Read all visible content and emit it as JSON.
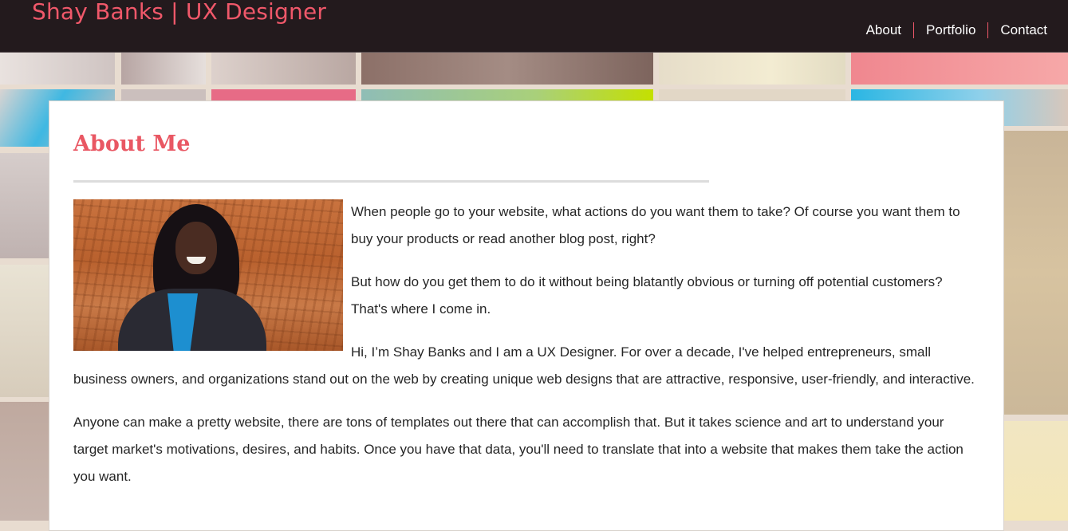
{
  "header": {
    "site_title": "Shay Banks | UX Designer",
    "nav": [
      "About",
      "Portfolio",
      "Contact"
    ],
    "colors": {
      "bar": "#231a1d",
      "title": "#f0586a",
      "divider": "#f0586a"
    }
  },
  "about": {
    "heading": "About Me",
    "image_alt": "Portrait of Shay Banks",
    "paragraphs": [
      "When people go to your website, what actions do you want them to take? Of course you want them to buy your products or read another blog post, right?",
      "But how do you get them to do it without being blatantly obvious or turning off potential customers? That's where I come in.",
      "Hi, I’m Shay Banks and I am a UX Designer. For over a decade, I've helped entrepreneurs, small business owners, and organizations stand out on the web by creating unique web designs that are attractive, responsive, user-friendly, and interactive.",
      "Anyone can make a pretty website, there are tons of templates out there that can accomplish that. But it takes science and art to understand your target market's motivations, desires, and habits. Once you have that data, you'll need to translate that into a website that makes them take the action you want."
    ],
    "colors": {
      "heading": "#e95763",
      "text": "#262626"
    }
  }
}
